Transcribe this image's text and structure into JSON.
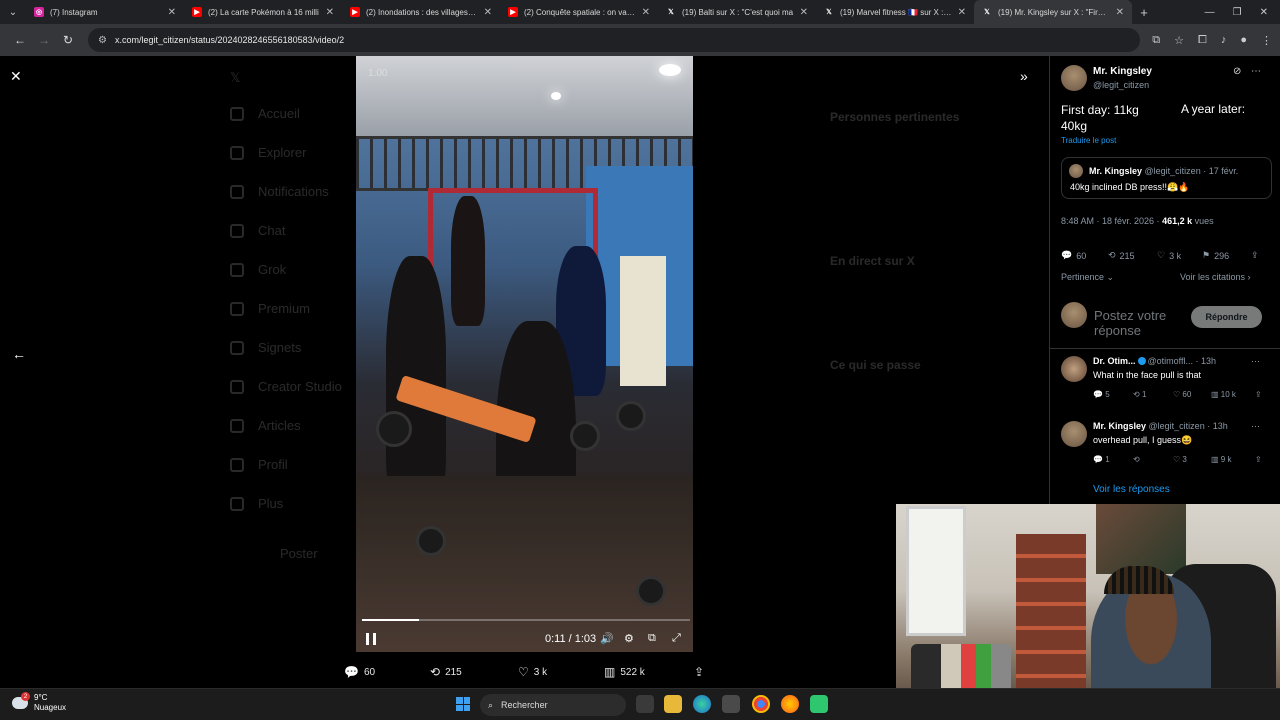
{
  "browser": {
    "tabs": [
      {
        "title": "(7) Instagram",
        "favicon": "instagram-icon",
        "color": "#d6249f"
      },
      {
        "title": "(2) La carte Pokémon à 16 milli",
        "favicon": "youtube-icon",
        "color": "#ff0000"
      },
      {
        "title": "(2) Inondations : des villages co",
        "favicon": "youtube-icon",
        "color": "#ff0000"
      },
      {
        "title": "(2) Conquête spatiale : on va re",
        "favicon": "youtube-icon",
        "color": "#ff0000"
      },
      {
        "title": "(19) Balti sur X : \"C'est quoi ma",
        "favicon": "x-icon",
        "color": "#000000"
      },
      {
        "title": "(19) Marvel fitness 🇫🇷 sur X : \"Pu",
        "favicon": "x-icon",
        "color": "#000000"
      },
      {
        "title": "(19) Mr. Kingsley sur X : \"First d",
        "favicon": "x-icon",
        "color": "#000000",
        "active": true
      }
    ],
    "url": "x.com/legit_citizen/status/2024028246556180583/video/2"
  },
  "background_page": {
    "nav": [
      "Accueil",
      "Explorer",
      "Notifications",
      "Chat",
      "Grok",
      "Premium",
      "Signets",
      "Creator Studio",
      "Articles",
      "Profil",
      "Plus"
    ],
    "post_button": "Poster",
    "right": [
      "Personnes pertinentes",
      "En direct sur X",
      "Ce qui se passe"
    ]
  },
  "video": {
    "time": "0:11 / 1:03",
    "speed": "1.00",
    "progress": 0.175,
    "stats": {
      "replies": "60",
      "reposts": "215",
      "likes": "3 k",
      "views": "522 k"
    }
  },
  "post": {
    "author_name": "Mr. Kingsley",
    "author_handle": "@legit_citizen",
    "text_a": "First day: 11kg",
    "text_a2": "40kg",
    "text_b": "A year later:",
    "translate": "Traduire le post",
    "quote": {
      "name": "Mr. Kingsley",
      "handle": "@legit_citizen · 17 févr.",
      "text": "40kg inclined DB press!!😤🔥"
    },
    "meta_time": "8:48 AM · 18 févr. 2026 · ",
    "meta_views": "461,2 k",
    "meta_views_label": " vues",
    "actions": {
      "replies": "60",
      "reposts": "215",
      "likes": "3 k",
      "bookmarks": "296"
    },
    "sort": "Pertinence",
    "quotes_link": "Voir les citations",
    "reply_placeholder": "Postez votre réponse",
    "reply_button": "Répondre"
  },
  "replies": [
    {
      "name": "Dr. Otim...",
      "handle": "@otimoffl... · 13h",
      "text": "What in the face pull is that",
      "replies": "5",
      "reposts": "1",
      "likes": "60",
      "views": "10 k",
      "verified": true
    },
    {
      "name": "Mr. Kingsley",
      "handle": "@legit_citizen · 13h",
      "text": "overhead pull, I guess😆",
      "replies": "1",
      "reposts": "",
      "likes": "3",
      "views": "9 k",
      "verified": false
    }
  ],
  "see_replies": "Voir les réponses",
  "taskbar": {
    "temp": "9°C",
    "weather": "Nuageux",
    "weather_badge": "2",
    "search": "Rechercher"
  },
  "colors": {
    "accent": "#1d9bf0",
    "bg": "#000000"
  }
}
